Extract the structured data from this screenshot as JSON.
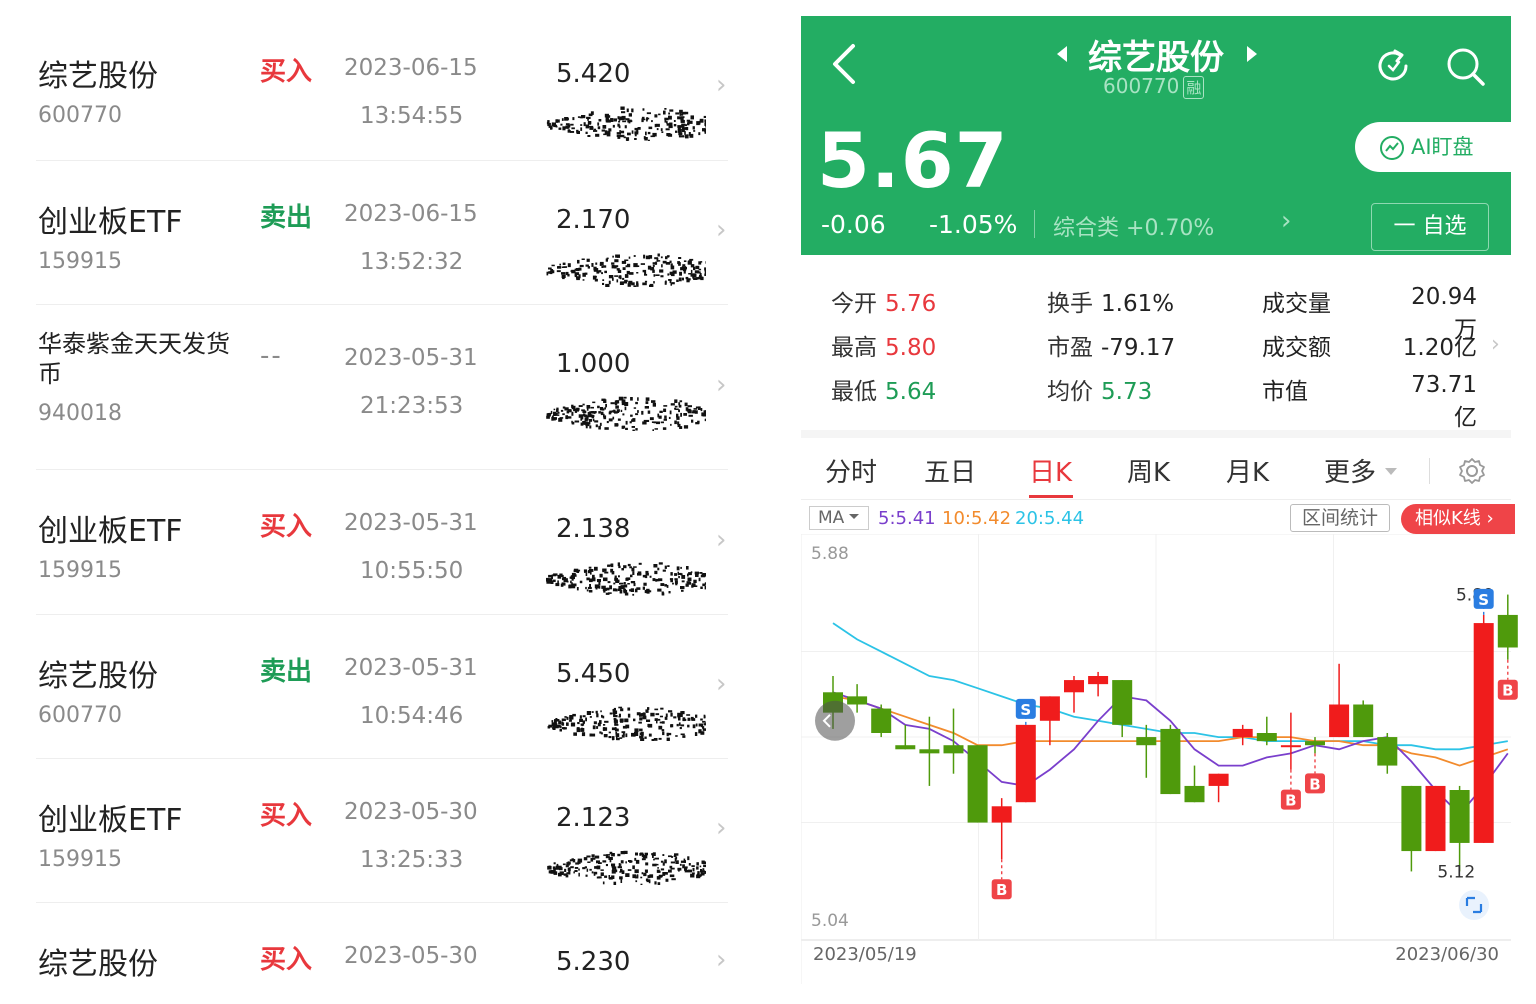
{
  "trades": [
    {
      "name": "综艺股份",
      "code": "600770",
      "action": "买入",
      "action_type": "buy",
      "date": "2023-06-15",
      "time": "13:54:55",
      "price": "5.420"
    },
    {
      "name": "创业板ETF",
      "code": "159915",
      "action": "卖出",
      "action_type": "sell",
      "date": "2023-06-15",
      "time": "13:52:32",
      "price": "2.170"
    },
    {
      "name": "华泰紫金天天发货币",
      "code": "940018",
      "action": "--",
      "action_type": "none",
      "date": "2023-05-31",
      "time": "21:23:53",
      "price": "1.000"
    },
    {
      "name": "创业板ETF",
      "code": "159915",
      "action": "买入",
      "action_type": "buy",
      "date": "2023-05-31",
      "time": "10:55:50",
      "price": "2.138"
    },
    {
      "name": "综艺股份",
      "code": "600770",
      "action": "卖出",
      "action_type": "sell",
      "date": "2023-05-31",
      "time": "10:54:46",
      "price": "5.450"
    },
    {
      "name": "创业板ETF",
      "code": "159915",
      "action": "买入",
      "action_type": "buy",
      "date": "2023-05-30",
      "time": "13:25:33",
      "price": "2.123"
    },
    {
      "name": "综艺股份",
      "code": "",
      "action": "买入",
      "action_type": "buy",
      "date": "2023-05-30",
      "time": "",
      "price": "5.230"
    }
  ],
  "stock": {
    "name": "综艺股份",
    "code": "600770",
    "margin_badge": "融",
    "price": "5.67",
    "change": "-0.06",
    "change_pct": "-1.05%",
    "sector_name": "综合类",
    "sector_change": "+0.70%",
    "ai_button": "AI盯盘",
    "watch_button": "一 自选"
  },
  "stats": {
    "open_label": "今开",
    "open": "5.76",
    "high_label": "最高",
    "high": "5.80",
    "low_label": "最低",
    "low": "5.64",
    "turnover_label": "换手",
    "turnover": "1.61%",
    "pe_label": "市盈",
    "pe": "-79.17",
    "avg_label": "均价",
    "avg": "5.73",
    "volume_label": "成交量",
    "volume": "20.94万",
    "amount_label": "成交额",
    "amount": "1.20亿",
    "mktcap_label": "市值",
    "mktcap": "73.71亿"
  },
  "tabs": [
    "分时",
    "五日",
    "日K",
    "周K",
    "月K",
    "更多"
  ],
  "active_tab": "日K",
  "ma": {
    "select": "MA",
    "ma5": "5:5.41",
    "ma10": "10:5.42",
    "ma20": "20:5.44",
    "range_btn": "区间统计",
    "similar_btn": "相似K线 ›"
  },
  "colors": {
    "header_green": "#23ad63",
    "up_red": "#e8383d",
    "down_green": "#1e9c56",
    "candle_up": "#f01c1c",
    "candle_down": "#4f9a0c",
    "ma5": "#7a3fcc",
    "ma10": "#f28b2d",
    "ma20": "#2cc3e6"
  },
  "chart_data": {
    "type": "candlestick",
    "y_top_label": "5.88",
    "y_bottom_label": "5.04",
    "ylim": [
      5.04,
      5.88
    ],
    "x_start_label": "2023/05/19",
    "x_end_label": "2023/06/30",
    "max_label": "5.80",
    "min_label": "5.12",
    "candles": [
      {
        "o": 5.56,
        "h": 5.6,
        "l": 5.47,
        "c": 5.51
      },
      {
        "o": 5.55,
        "h": 5.58,
        "l": 5.51,
        "c": 5.53
      },
      {
        "o": 5.52,
        "h": 5.53,
        "l": 5.45,
        "c": 5.46
      },
      {
        "o": 5.43,
        "h": 5.48,
        "l": 5.42,
        "c": 5.42
      },
      {
        "o": 5.42,
        "h": 5.5,
        "l": 5.33,
        "c": 5.41
      },
      {
        "o": 5.43,
        "h": 5.52,
        "l": 5.36,
        "c": 5.41
      },
      {
        "o": 5.43,
        "h": 5.43,
        "l": 5.24,
        "c": 5.24
      },
      {
        "o": 5.24,
        "h": 5.3,
        "l": 5.15,
        "c": 5.28
      },
      {
        "o": 5.29,
        "h": 5.48,
        "l": 5.29,
        "c": 5.48
      },
      {
        "o": 5.49,
        "h": 5.55,
        "l": 5.43,
        "c": 5.55
      },
      {
        "o": 5.56,
        "h": 5.6,
        "l": 5.51,
        "c": 5.59
      },
      {
        "o": 5.58,
        "h": 5.61,
        "l": 5.55,
        "c": 5.6
      },
      {
        "o": 5.59,
        "h": 5.59,
        "l": 5.45,
        "c": 5.48
      },
      {
        "o": 5.45,
        "h": 5.48,
        "l": 5.35,
        "c": 5.43
      },
      {
        "o": 5.47,
        "h": 5.48,
        "l": 5.31,
        "c": 5.31
      },
      {
        "o": 5.33,
        "h": 5.38,
        "l": 5.29,
        "c": 5.29
      },
      {
        "o": 5.33,
        "h": 5.36,
        "l": 5.29,
        "c": 5.36
      },
      {
        "o": 5.45,
        "h": 5.48,
        "l": 5.43,
        "c": 5.47
      },
      {
        "o": 5.46,
        "h": 5.5,
        "l": 5.43,
        "c": 5.44
      },
      {
        "o": 5.43,
        "h": 5.51,
        "l": 5.37,
        "c": 5.43
      },
      {
        "o": 5.44,
        "h": 5.45,
        "l": 5.41,
        "c": 5.43
      },
      {
        "o": 5.45,
        "h": 5.63,
        "l": 5.45,
        "c": 5.53
      },
      {
        "o": 5.53,
        "h": 5.54,
        "l": 5.45,
        "c": 5.45
      },
      {
        "o": 5.45,
        "h": 5.46,
        "l": 5.36,
        "c": 5.38
      },
      {
        "o": 5.33,
        "h": 5.33,
        "l": 5.12,
        "c": 5.17
      },
      {
        "o": 5.17,
        "h": 5.33,
        "l": 5.17,
        "c": 5.33
      },
      {
        "o": 5.32,
        "h": 5.33,
        "l": 5.12,
        "c": 5.19
      },
      {
        "o": 5.19,
        "h": 5.75,
        "l": 5.19,
        "c": 5.73
      },
      {
        "o": 5.75,
        "h": 5.8,
        "l": 5.64,
        "c": 5.67
      }
    ],
    "ma5_line": [
      5.56,
      5.54,
      5.52,
      5.48,
      5.47,
      5.44,
      5.39,
      5.34,
      5.33,
      5.37,
      5.42,
      5.49,
      5.55,
      5.54,
      5.49,
      5.42,
      5.38,
      5.38,
      5.4,
      5.41,
      5.43,
      5.42,
      5.44,
      5.45,
      5.39,
      5.32,
      5.26,
      5.33,
      5.41
    ],
    "ma10_line": [
      5.55,
      5.54,
      5.52,
      5.5,
      5.48,
      5.46,
      5.43,
      5.43,
      5.44,
      5.44,
      5.44,
      5.44,
      5.44,
      5.44,
      5.44,
      5.44,
      5.44,
      5.45,
      5.45,
      5.45,
      5.44,
      5.44,
      5.43,
      5.43,
      5.41,
      5.4,
      5.38,
      5.4,
      5.42
    ],
    "ma20_line": [
      5.73,
      5.69,
      5.66,
      5.63,
      5.6,
      5.59,
      5.57,
      5.55,
      5.53,
      5.52,
      5.5,
      5.49,
      5.48,
      5.47,
      5.46,
      5.46,
      5.45,
      5.45,
      5.44,
      5.44,
      5.44,
      5.44,
      5.44,
      5.43,
      5.43,
      5.42,
      5.42,
      5.43,
      5.44
    ],
    "markers": [
      {
        "type": "S",
        "index": 8
      },
      {
        "type": "B",
        "index": 7
      },
      {
        "type": "B",
        "index": 19
      },
      {
        "type": "B",
        "index": 20
      },
      {
        "type": "S",
        "index": 27
      },
      {
        "type": "B",
        "index": 28
      }
    ]
  }
}
